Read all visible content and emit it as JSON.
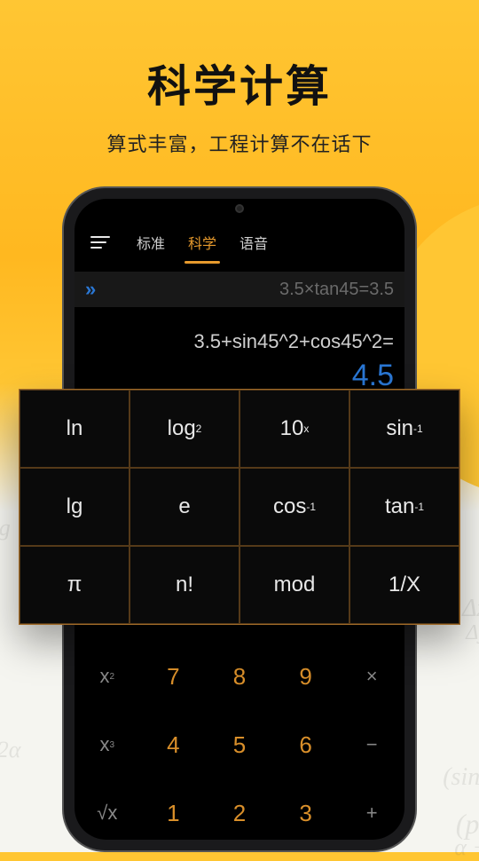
{
  "hero": {
    "title": "科学计算",
    "subtitle": "算式丰富，工程计算不在话下"
  },
  "tabs": {
    "standard": "标准",
    "scientific": "科学",
    "voice": "语音"
  },
  "history": {
    "expression": "3.5×tan45=3.5"
  },
  "calc": {
    "expression": "3.5+sin45^2+cos45^2=",
    "result": "4.5"
  },
  "sci_keys": {
    "r0c0": "ln",
    "r0c1_main": "log",
    "r0c1_sub": "2",
    "r0c2_main": "10",
    "r0c2_sup": "x",
    "r0c3_main": "sin",
    "r0c3_sup": "-1",
    "r1c0": "lg",
    "r1c1": "e",
    "r1c2_main": "cos",
    "r1c2_sup": "-1",
    "r1c3_main": "tan",
    "r1c3_sup": "-1",
    "r2c0": "π",
    "r2c1": "n!",
    "r2c2": "mod",
    "r2c3": "1/X"
  },
  "lower_keys": {
    "r0c0_main": "x",
    "r0c0_sup": "2",
    "r0c1": "7",
    "r0c2": "8",
    "r0c3": "9",
    "r0c4": "×",
    "r1c0_main": "x",
    "r1c0_sup": "3",
    "r1c1": "4",
    "r1c2": "5",
    "r1c3": "6",
    "r1c4": "−",
    "r2c0": "√x",
    "r2c1": "1",
    "r2c2": "2",
    "r2c3": "3",
    "r2c4": "+"
  }
}
